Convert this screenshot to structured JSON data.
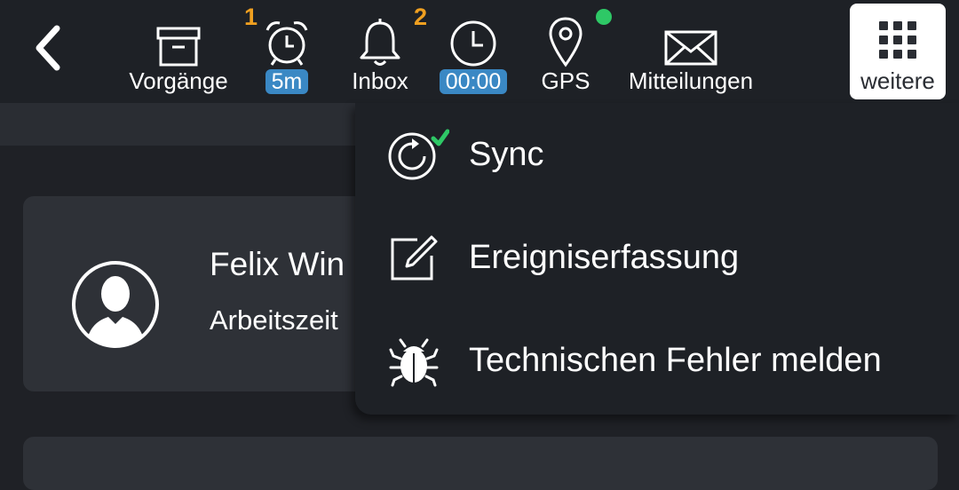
{
  "toolbar": {
    "vorgaenge": {
      "label": "Vorgänge",
      "badge": "1",
      "icon": "archive-box-icon"
    },
    "alarm": {
      "pill": "5m",
      "icon": "alarm-clock-icon"
    },
    "inbox": {
      "label": "Inbox",
      "badge": "2",
      "icon": "bell-icon"
    },
    "time": {
      "pill": "00:00",
      "icon": "clock-icon"
    },
    "gps": {
      "label": "GPS",
      "status": "active",
      "icon": "map-pin-icon"
    },
    "mitteilungen": {
      "label": "Mitteilungen",
      "icon": "envelope-icon"
    },
    "weitere": {
      "label": "weitere",
      "icon": "grid-icon"
    }
  },
  "profile": {
    "name": "Felix Win",
    "subtitle": "Arbeitszeit"
  },
  "menu": {
    "items": [
      {
        "label": "Sync",
        "icon": "sync-icon",
        "checked": true
      },
      {
        "label": "Ereigniserfassung",
        "icon": "edit-icon"
      },
      {
        "label": "Technischen Fehler melden",
        "icon": "bug-icon"
      }
    ]
  },
  "colors": {
    "badge": "#f0a020",
    "pill": "#3a88c4",
    "gps_dot": "#2ec866",
    "check": "#2ec866",
    "background": "#1f2126"
  }
}
